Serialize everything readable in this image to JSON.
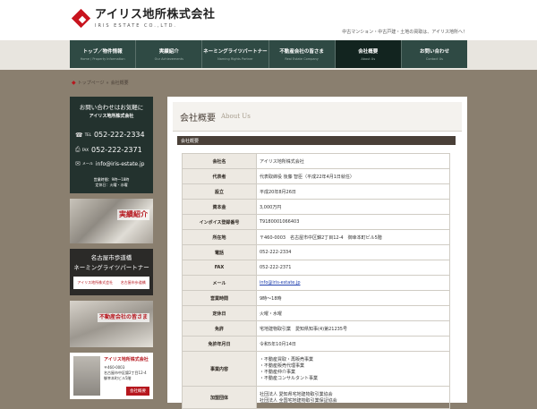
{
  "header": {
    "logo_jp": "アイリス地所株式会社",
    "logo_en": "IRIS ESTATE CO.,LTD.",
    "tagline": "中古マンション・中古戸建・土地の買取は、アイリス地所へ！"
  },
  "nav": [
    {
      "label": "トップ／物件情報",
      "sub": "Home / Property Information"
    },
    {
      "label": "実績紹介",
      "sub": "Our Achievements"
    },
    {
      "label": "ネーミングライツパートナー",
      "sub": "Naming Rights Partner"
    },
    {
      "label": "不動産会社の皆さま",
      "sub": "Real Estate Company"
    },
    {
      "label": "会社概要",
      "sub": "About Us"
    },
    {
      "label": "お問い合わせ",
      "sub": "Contact Us"
    }
  ],
  "breadcrumb": {
    "home": "トップページ",
    "sep": "»",
    "current": "会社概要"
  },
  "sidebar": {
    "contact": {
      "title": "お問い合わせはお気軽に",
      "company": "アイリス地所株式会社",
      "tel_tag": "TEL",
      "tel": "052-222-2334",
      "fax_tag": "FAX",
      "fax": "052-222-2371",
      "mail_tag": "メール",
      "mail": "info@iris-estate.jp",
      "hours1": "営業時間：9時～18時",
      "hours2": "定休日：火曜・水曜"
    },
    "banner_results": "実績紹介",
    "banner_partner_l1": "名古屋市歩道橋",
    "banner_partner_l2": "ネーミングライツパートナー",
    "banner_partner_strip_a": "アイリス地所株式会社",
    "banner_partner_strip_b": "名古屋市歩道橋",
    "banner_company": "不動産会社の皆さま",
    "banner_office_co": "アイリス地所株式会社",
    "banner_office_addr1": "〒460-0003",
    "banner_office_addr2": "名古屋市中区錦2丁目12-4",
    "banner_office_addr3": "御幸本町ビル5階",
    "banner_office_btn": "会社概要"
  },
  "main": {
    "title": "会社概要",
    "title_en": "About Us",
    "section": "会社概要",
    "rows": [
      {
        "k": "会社名",
        "v": "アイリス地所株式会社"
      },
      {
        "k": "代表者",
        "v": "代表取締役 後藤 智臣（平成22年4月1日就任）"
      },
      {
        "k": "設立",
        "v": "平成20年8月26日"
      },
      {
        "k": "資本金",
        "v": "3,000万円"
      },
      {
        "k": "インボイス登録番号",
        "v": "T9180001066403"
      },
      {
        "k": "所在地",
        "v": "〒460-0003　名古屋市中区錦2丁目12-4　御幸本町ビル5階"
      },
      {
        "k": "電話",
        "v": "052-222-2334"
      },
      {
        "k": "FAX",
        "v": "052-222-2371"
      },
      {
        "k": "メール",
        "v": "info@iris-estate.jp"
      },
      {
        "k": "営業時間",
        "v": "9時～18時"
      },
      {
        "k": "定休日",
        "v": "火曜・水曜"
      },
      {
        "k": "免許",
        "v": "宅地建物取引業　愛知県知事(4)第21235号"
      },
      {
        "k": "免許年月日",
        "v": "令和5年10月14日"
      }
    ],
    "business_k": "事業内容",
    "business": [
      "・不動産買取・再販売事業",
      "・不動産販売代理事業",
      "・不動産仲介事業",
      "・不動産コンサルタント事業"
    ],
    "org_k": "加盟団体",
    "org": [
      "社団法人 愛知県宅地建物取引業協会",
      "社団法人 全国宅地建物取引業保証協会"
    ]
  }
}
